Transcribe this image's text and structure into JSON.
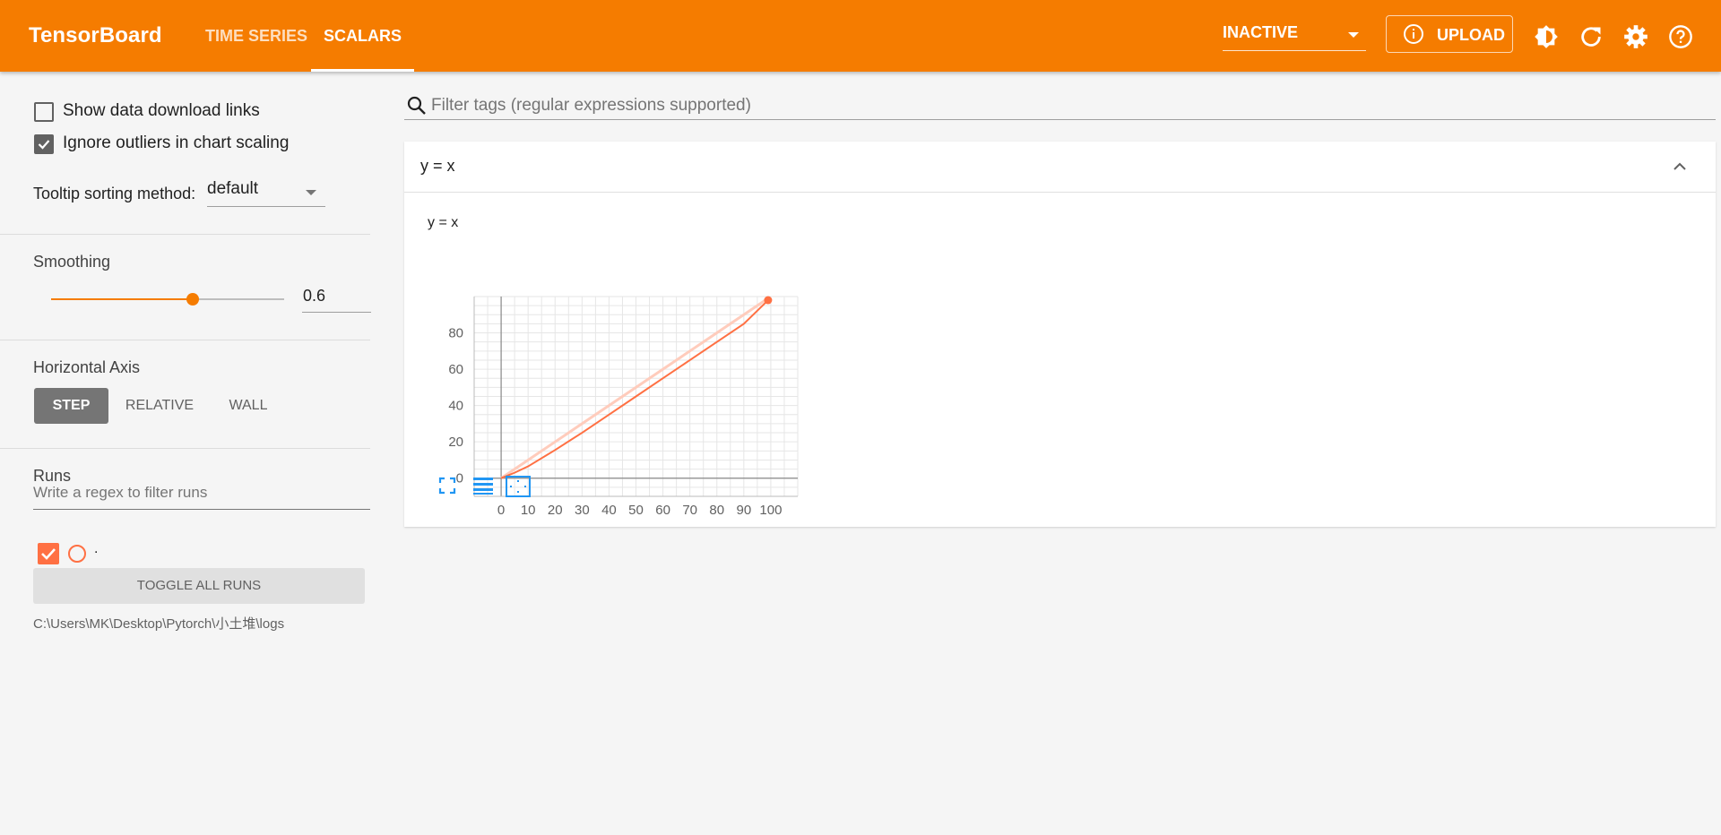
{
  "header": {
    "brand": "TensorBoard",
    "tabs": [
      {
        "label": "TIME SERIES",
        "active": false
      },
      {
        "label": "SCALARS",
        "active": true
      }
    ],
    "reload_status": "INACTIVE",
    "upload_label": "UPLOAD",
    "icons": [
      "brightness-icon",
      "refresh-icon",
      "settings-icon",
      "help-icon"
    ],
    "color": "#f57c00"
  },
  "sidebar": {
    "show_download_links": {
      "label": "Show data download links",
      "checked": false
    },
    "ignore_outliers": {
      "label": "Ignore outliers in chart scaling",
      "checked": true
    },
    "tooltip_sorting": {
      "label": "Tooltip sorting method:",
      "value": "default"
    },
    "smoothing": {
      "title": "Smoothing",
      "value": "0.6"
    },
    "horizontal_axis": {
      "title": "Horizontal Axis",
      "options": [
        "STEP",
        "RELATIVE",
        "WALL"
      ],
      "selected": "STEP"
    },
    "runs": {
      "title": "Runs",
      "filter_placeholder": "Write a regex to filter runs",
      "items": [
        {
          "name": ".",
          "checked": true,
          "color": "#ff7043"
        }
      ],
      "toggle_label": "TOGGLE ALL RUNS",
      "logdir": "C:\\Users\\MK\\Desktop\\Pytorch\\小土堆\\logs"
    }
  },
  "main": {
    "filter_placeholder": "Filter tags (regular expressions supported)",
    "card": {
      "title": "y = x"
    }
  },
  "chart_data": {
    "type": "line",
    "title": "y = x",
    "x": [
      0,
      5,
      10,
      20,
      30,
      40,
      50,
      60,
      70,
      80,
      90,
      99
    ],
    "series": [
      {
        "name": ".",
        "color": "#ff7043",
        "values": [
          0,
          3,
          6.5,
          15.5,
          25,
          35,
          45,
          55,
          65,
          75,
          85,
          98
        ]
      }
    ],
    "raw_series_color": "#ffccbc",
    "xticks": [
      "0",
      "10",
      "20",
      "30",
      "40",
      "50",
      "60",
      "70",
      "80",
      "90",
      "100"
    ],
    "yticks": [
      "0",
      "20",
      "40",
      "60",
      "80"
    ],
    "xlim": [
      -10,
      110
    ],
    "ylim": [
      -10,
      100
    ],
    "grid": true,
    "xlabel": "",
    "ylabel": ""
  }
}
